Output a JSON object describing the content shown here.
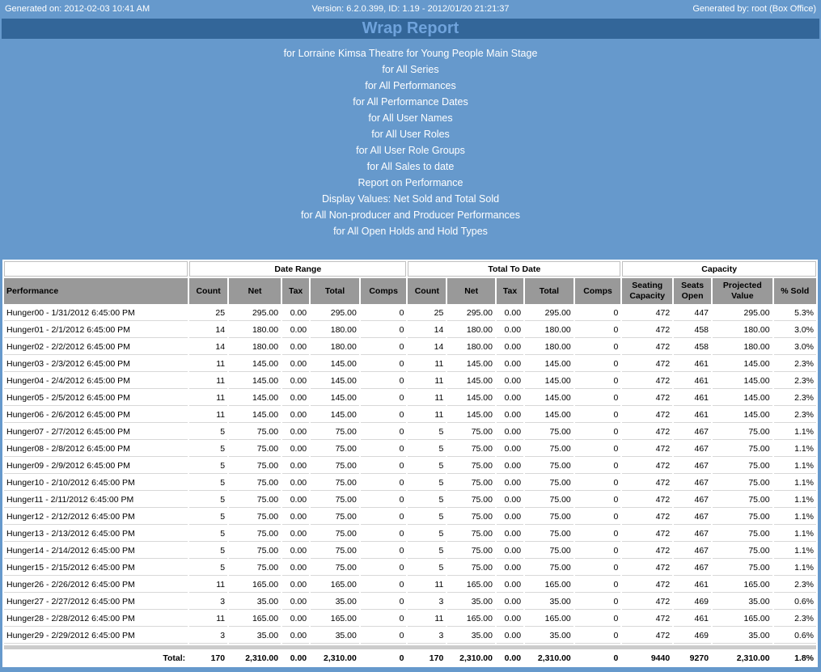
{
  "header": {
    "generated_on": "Generated on: 2012-02-03 10:41 AM",
    "version": "Version: 6.2.0.399, ID: 1.19 - 2012/01/20 21:21:37",
    "generated_by": "Generated by: root (Box Office)"
  },
  "title": "Wrap Report",
  "parameters": [
    "for Lorraine Kimsa Theatre for Young People Main Stage",
    "for All Series",
    "for All Performances",
    "for All Performance Dates",
    "for All User Names",
    "for All User Roles",
    "for All User Role Groups",
    "for All Sales to date",
    "Report on Performance",
    "Display Values: Net Sold and Total Sold",
    "for All Non-producer and Producer Performances",
    "for All Open Holds and Hold Types"
  ],
  "table": {
    "groups": [
      "Date Range",
      "Total To Date",
      "Capacity"
    ],
    "columns": [
      "Performance",
      "Count",
      "Net",
      "Tax",
      "Total",
      "Comps",
      "Count",
      "Net",
      "Tax",
      "Total",
      "Comps",
      "Seating Capacity",
      "Seats Open",
      "Projected Value",
      "% Sold"
    ],
    "rows": [
      [
        "Hunger00 - 1/31/2012 6:45:00 PM",
        "25",
        "295.00",
        "0.00",
        "295.00",
        "0",
        "25",
        "295.00",
        "0.00",
        "295.00",
        "0",
        "472",
        "447",
        "295.00",
        "5.3%"
      ],
      [
        "Hunger01 - 2/1/2012 6:45:00 PM",
        "14",
        "180.00",
        "0.00",
        "180.00",
        "0",
        "14",
        "180.00",
        "0.00",
        "180.00",
        "0",
        "472",
        "458",
        "180.00",
        "3.0%"
      ],
      [
        "Hunger02 - 2/2/2012 6:45:00 PM",
        "14",
        "180.00",
        "0.00",
        "180.00",
        "0",
        "14",
        "180.00",
        "0.00",
        "180.00",
        "0",
        "472",
        "458",
        "180.00",
        "3.0%"
      ],
      [
        "Hunger03 - 2/3/2012 6:45:00 PM",
        "11",
        "145.00",
        "0.00",
        "145.00",
        "0",
        "11",
        "145.00",
        "0.00",
        "145.00",
        "0",
        "472",
        "461",
        "145.00",
        "2.3%"
      ],
      [
        "Hunger04 - 2/4/2012 6:45:00 PM",
        "11",
        "145.00",
        "0.00",
        "145.00",
        "0",
        "11",
        "145.00",
        "0.00",
        "145.00",
        "0",
        "472",
        "461",
        "145.00",
        "2.3%"
      ],
      [
        "Hunger05 - 2/5/2012 6:45:00 PM",
        "11",
        "145.00",
        "0.00",
        "145.00",
        "0",
        "11",
        "145.00",
        "0.00",
        "145.00",
        "0",
        "472",
        "461",
        "145.00",
        "2.3%"
      ],
      [
        "Hunger06 - 2/6/2012 6:45:00 PM",
        "11",
        "145.00",
        "0.00",
        "145.00",
        "0",
        "11",
        "145.00",
        "0.00",
        "145.00",
        "0",
        "472",
        "461",
        "145.00",
        "2.3%"
      ],
      [
        "Hunger07 - 2/7/2012 6:45:00 PM",
        "5",
        "75.00",
        "0.00",
        "75.00",
        "0",
        "5",
        "75.00",
        "0.00",
        "75.00",
        "0",
        "472",
        "467",
        "75.00",
        "1.1%"
      ],
      [
        "Hunger08 - 2/8/2012 6:45:00 PM",
        "5",
        "75.00",
        "0.00",
        "75.00",
        "0",
        "5",
        "75.00",
        "0.00",
        "75.00",
        "0",
        "472",
        "467",
        "75.00",
        "1.1%"
      ],
      [
        "Hunger09 - 2/9/2012 6:45:00 PM",
        "5",
        "75.00",
        "0.00",
        "75.00",
        "0",
        "5",
        "75.00",
        "0.00",
        "75.00",
        "0",
        "472",
        "467",
        "75.00",
        "1.1%"
      ],
      [
        "Hunger10 - 2/10/2012 6:45:00 PM",
        "5",
        "75.00",
        "0.00",
        "75.00",
        "0",
        "5",
        "75.00",
        "0.00",
        "75.00",
        "0",
        "472",
        "467",
        "75.00",
        "1.1%"
      ],
      [
        "Hunger11 - 2/11/2012 6:45:00 PM",
        "5",
        "75.00",
        "0.00",
        "75.00",
        "0",
        "5",
        "75.00",
        "0.00",
        "75.00",
        "0",
        "472",
        "467",
        "75.00",
        "1.1%"
      ],
      [
        "Hunger12 - 2/12/2012 6:45:00 PM",
        "5",
        "75.00",
        "0.00",
        "75.00",
        "0",
        "5",
        "75.00",
        "0.00",
        "75.00",
        "0",
        "472",
        "467",
        "75.00",
        "1.1%"
      ],
      [
        "Hunger13 - 2/13/2012 6:45:00 PM",
        "5",
        "75.00",
        "0.00",
        "75.00",
        "0",
        "5",
        "75.00",
        "0.00",
        "75.00",
        "0",
        "472",
        "467",
        "75.00",
        "1.1%"
      ],
      [
        "Hunger14 - 2/14/2012 6:45:00 PM",
        "5",
        "75.00",
        "0.00",
        "75.00",
        "0",
        "5",
        "75.00",
        "0.00",
        "75.00",
        "0",
        "472",
        "467",
        "75.00",
        "1.1%"
      ],
      [
        "Hunger15 - 2/15/2012 6:45:00 PM",
        "5",
        "75.00",
        "0.00",
        "75.00",
        "0",
        "5",
        "75.00",
        "0.00",
        "75.00",
        "0",
        "472",
        "467",
        "75.00",
        "1.1%"
      ],
      [
        "Hunger26 - 2/26/2012 6:45:00 PM",
        "11",
        "165.00",
        "0.00",
        "165.00",
        "0",
        "11",
        "165.00",
        "0.00",
        "165.00",
        "0",
        "472",
        "461",
        "165.00",
        "2.3%"
      ],
      [
        "Hunger27 - 2/27/2012 6:45:00 PM",
        "3",
        "35.00",
        "0.00",
        "35.00",
        "0",
        "3",
        "35.00",
        "0.00",
        "35.00",
        "0",
        "472",
        "469",
        "35.00",
        "0.6%"
      ],
      [
        "Hunger28 - 2/28/2012 6:45:00 PM",
        "11",
        "165.00",
        "0.00",
        "165.00",
        "0",
        "11",
        "165.00",
        "0.00",
        "165.00",
        "0",
        "472",
        "461",
        "165.00",
        "2.3%"
      ],
      [
        "Hunger29 - 2/29/2012 6:45:00 PM",
        "3",
        "35.00",
        "0.00",
        "35.00",
        "0",
        "3",
        "35.00",
        "0.00",
        "35.00",
        "0",
        "472",
        "469",
        "35.00",
        "0.6%"
      ]
    ],
    "total": [
      "Total:",
      "170",
      "2,310.00",
      "0.00",
      "2,310.00",
      "0",
      "170",
      "2,310.00",
      "0.00",
      "2,310.00",
      "0",
      "9440",
      "9270",
      "2,310.00",
      "1.8%"
    ]
  },
  "colors": {
    "background": "#6699cc",
    "title_bar": "#336699",
    "header_row": "#999999"
  }
}
